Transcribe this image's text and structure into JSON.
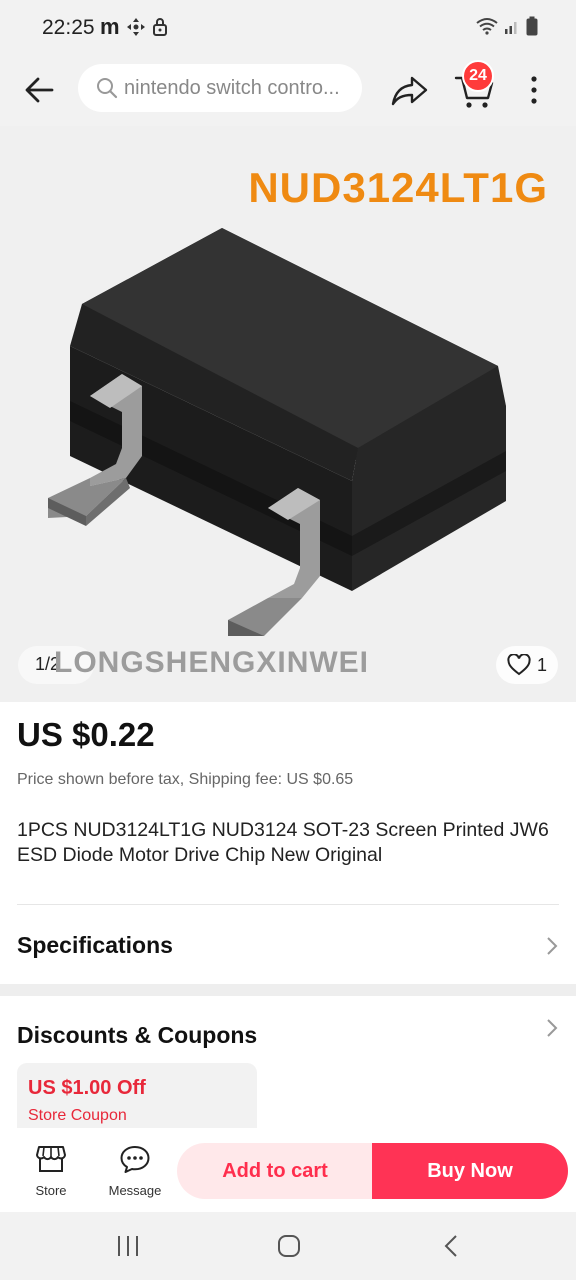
{
  "status_bar": {
    "time": "22:25",
    "left_icons": [
      "m-app-icon",
      "move-icon",
      "lock-icon"
    ],
    "right_icons": [
      "wifi-icon",
      "signal-icon",
      "battery-icon"
    ]
  },
  "top_bar": {
    "search_placeholder": "nintendo switch contro...",
    "cart_count": "24",
    "icons": [
      "back-arrow-icon",
      "search-icon",
      "share-icon",
      "cart-icon",
      "more-icon"
    ]
  },
  "gallery": {
    "product_code": "NUD3124LT1G",
    "watermark": "LONGSHENGXINWEI",
    "pager": "1/2",
    "likes": "1",
    "accent_color": "#ef8a12"
  },
  "product": {
    "price": "US $0.22",
    "price_note": "Price shown before tax, Shipping fee: US $0.65",
    "title": "1PCS NUD3124LT1G NUD3124 SOT-23 Screen Printed JW6 ESD Diode Motor Drive Chip New Original"
  },
  "sections": {
    "specifications": "Specifications",
    "discounts": "Discounts & Coupons"
  },
  "coupon": {
    "amount": "US $1.00 Off",
    "label": "Store Coupon"
  },
  "action_bar": {
    "store_label": "Store",
    "message_label": "Message",
    "add_to_cart": "Add to cart",
    "buy_now": "Buy Now",
    "brand_color": "#ff3355"
  },
  "nav_bar": {
    "icons": [
      "recents-icon",
      "home-icon",
      "back-icon"
    ]
  }
}
